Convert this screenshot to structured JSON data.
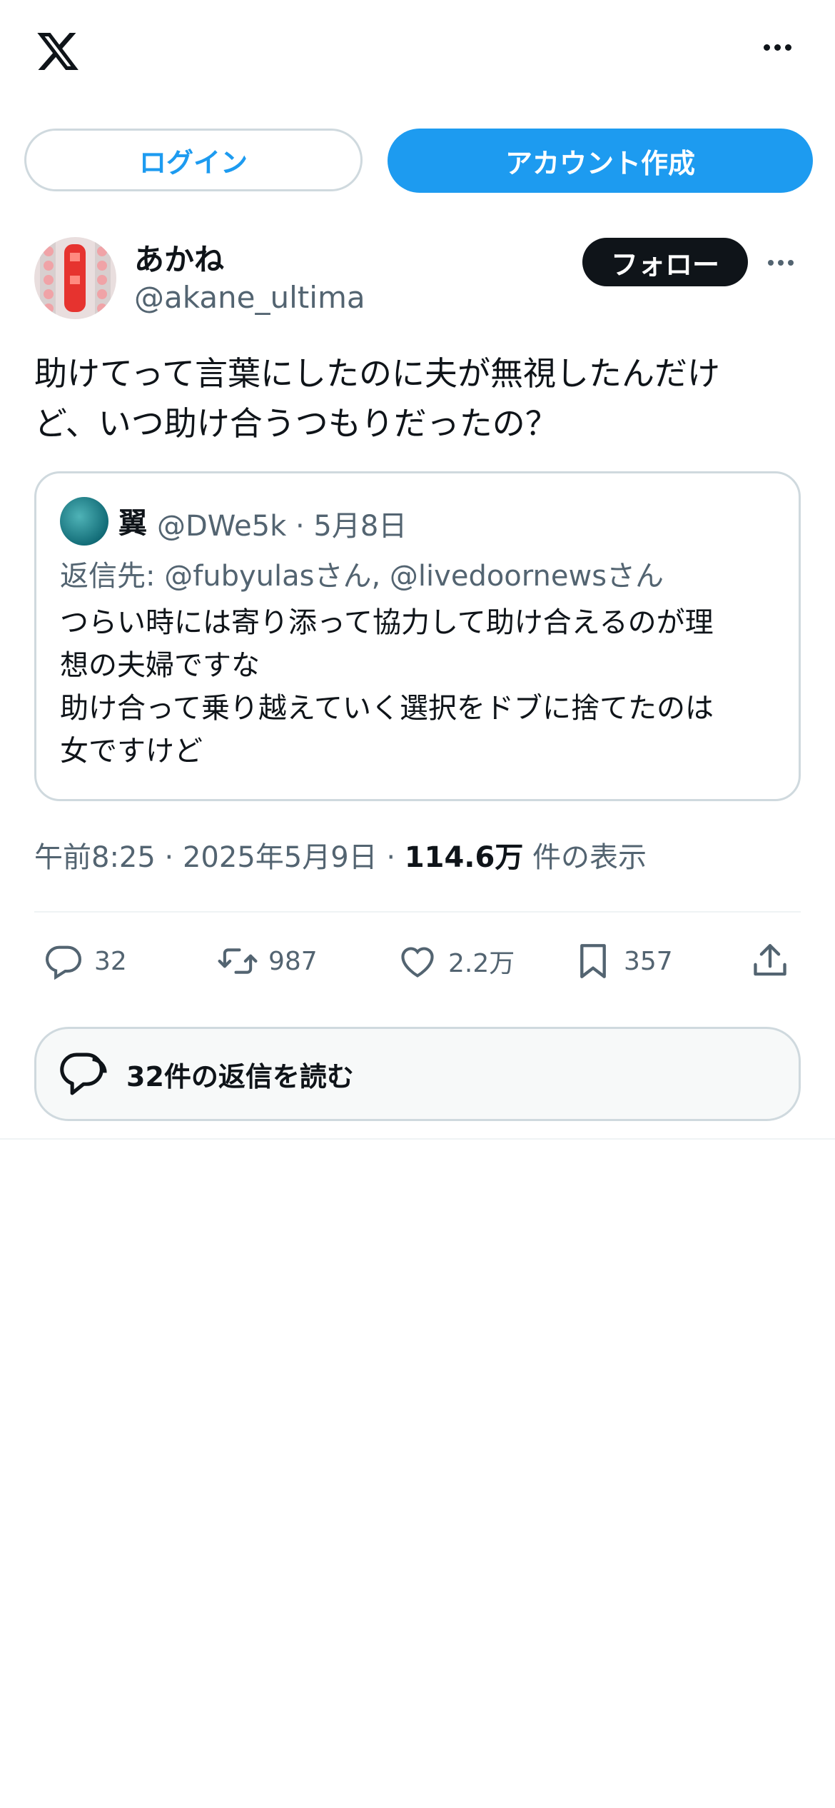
{
  "header": {
    "logo_icon": "x-logo-icon",
    "more_icon": "more-horizontal-icon"
  },
  "auth": {
    "login_label": "ログイン",
    "signup_label": "アカウント作成"
  },
  "author": {
    "name": "あかね",
    "handle": "@akane_ultima",
    "follow_label": "フォロー"
  },
  "tweet": {
    "text": "助けてって言葉にしたのに夫が無視したんだけ\nど、いつ助け合うつもりだったの？",
    "time": "午前8:25 · 2025年5月9日 · ",
    "views_count": "114.6万",
    "views_label": " 件の表示"
  },
  "quote": {
    "name": "翼",
    "meta": "@DWe5k · 5月8日",
    "reply_to": "返信先: @fubyulasさん, @livedoornewsさん",
    "text": "つらい時には寄り添って協力して助け合えるのが理\n想の夫婦ですな\n助け合って乗り越えていく選択をドブに捨てたのは\n女ですけど"
  },
  "actions": {
    "replies": "32",
    "reposts": "987",
    "likes": "2.2万",
    "bookmarks": "357"
  },
  "read_replies_label": "32件の返信を読む",
  "colors": {
    "accent": "#1d9bf0",
    "text": "#0f1419",
    "muted": "#536471",
    "border": "#cfd9de"
  }
}
